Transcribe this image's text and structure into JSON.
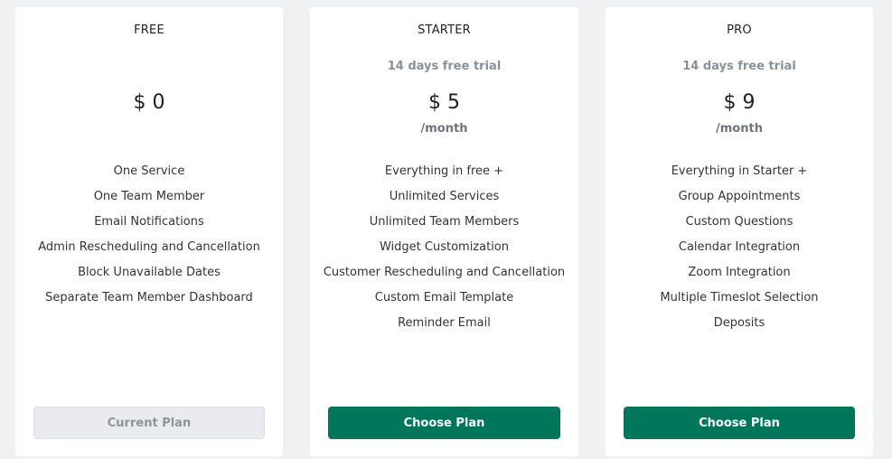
{
  "plans": [
    {
      "name": "FREE",
      "trial": "",
      "price": "$ 0",
      "period": "",
      "features": [
        "One Service",
        "One Team Member",
        "Email Notifications",
        "Admin Rescheduling and Cancellation",
        "Block Unavailable Dates",
        "Separate Team Member Dashboard"
      ],
      "button_label": "Current Plan",
      "is_current": true
    },
    {
      "name": "STARTER",
      "trial": "14 days free trial",
      "price": "$ 5",
      "period": "/month",
      "features": [
        "Everything in free +",
        "Unlimited Services",
        "Unlimited Team Members",
        "Widget Customization",
        "Customer Rescheduling and Cancellation",
        "Custom Email Template",
        "Reminder Email"
      ],
      "button_label": "Choose Plan",
      "is_current": false
    },
    {
      "name": "PRO",
      "trial": "14 days free trial",
      "price": "$ 9",
      "period": "/month",
      "features": [
        "Everything in Starter +",
        "Group Appointments",
        "Custom Questions",
        "Calendar Integration",
        "Zoom Integration",
        "Multiple Timeslot Selection",
        "Deposits"
      ],
      "button_label": "Choose Plan",
      "is_current": false
    }
  ],
  "colors": {
    "accent": "#00775a",
    "background": "#f0f1f3",
    "muted_text": "#8a8f98"
  }
}
